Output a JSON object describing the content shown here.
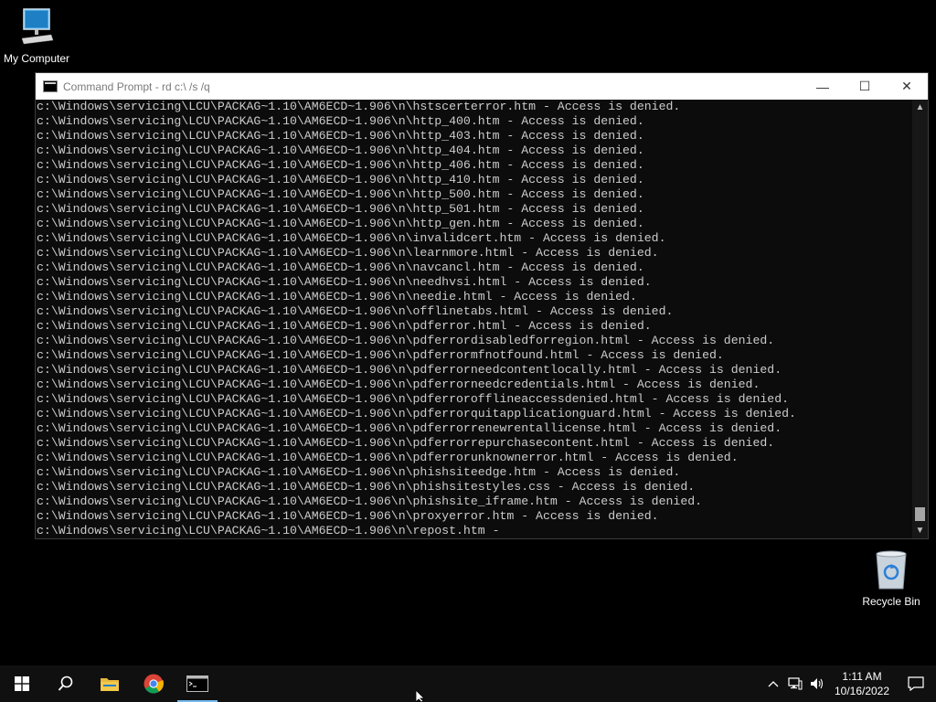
{
  "desktop": {
    "icons": [
      {
        "label": "My Computer",
        "icon": "computer-icon"
      },
      {
        "label": "Recycle Bin",
        "icon": "recycle-bin-icon"
      }
    ]
  },
  "window": {
    "title": "Command Prompt - rd  c:\\ /s /q",
    "minimize": "—",
    "maximize": "☐",
    "close": "✕"
  },
  "console": {
    "lines": [
      "c:\\Windows\\servicing\\LCU\\PACKAG~1.10\\AM6ECD~1.906\\n\\hstscerterror.htm - Access is denied.",
      "c:\\Windows\\servicing\\LCU\\PACKAG~1.10\\AM6ECD~1.906\\n\\http_400.htm - Access is denied.",
      "c:\\Windows\\servicing\\LCU\\PACKAG~1.10\\AM6ECD~1.906\\n\\http_403.htm - Access is denied.",
      "c:\\Windows\\servicing\\LCU\\PACKAG~1.10\\AM6ECD~1.906\\n\\http_404.htm - Access is denied.",
      "c:\\Windows\\servicing\\LCU\\PACKAG~1.10\\AM6ECD~1.906\\n\\http_406.htm - Access is denied.",
      "c:\\Windows\\servicing\\LCU\\PACKAG~1.10\\AM6ECD~1.906\\n\\http_410.htm - Access is denied.",
      "c:\\Windows\\servicing\\LCU\\PACKAG~1.10\\AM6ECD~1.906\\n\\http_500.htm - Access is denied.",
      "c:\\Windows\\servicing\\LCU\\PACKAG~1.10\\AM6ECD~1.906\\n\\http_501.htm - Access is denied.",
      "c:\\Windows\\servicing\\LCU\\PACKAG~1.10\\AM6ECD~1.906\\n\\http_gen.htm - Access is denied.",
      "c:\\Windows\\servicing\\LCU\\PACKAG~1.10\\AM6ECD~1.906\\n\\invalidcert.htm - Access is denied.",
      "c:\\Windows\\servicing\\LCU\\PACKAG~1.10\\AM6ECD~1.906\\n\\learnmore.html - Access is denied.",
      "c:\\Windows\\servicing\\LCU\\PACKAG~1.10\\AM6ECD~1.906\\n\\navcancl.htm - Access is denied.",
      "c:\\Windows\\servicing\\LCU\\PACKAG~1.10\\AM6ECD~1.906\\n\\needhvsi.html - Access is denied.",
      "c:\\Windows\\servicing\\LCU\\PACKAG~1.10\\AM6ECD~1.906\\n\\needie.html - Access is denied.",
      "c:\\Windows\\servicing\\LCU\\PACKAG~1.10\\AM6ECD~1.906\\n\\offlinetabs.html - Access is denied.",
      "c:\\Windows\\servicing\\LCU\\PACKAG~1.10\\AM6ECD~1.906\\n\\pdferror.html - Access is denied.",
      "c:\\Windows\\servicing\\LCU\\PACKAG~1.10\\AM6ECD~1.906\\n\\pdferrordisabledforregion.html - Access is denied.",
      "c:\\Windows\\servicing\\LCU\\PACKAG~1.10\\AM6ECD~1.906\\n\\pdferrormfnotfound.html - Access is denied.",
      "c:\\Windows\\servicing\\LCU\\PACKAG~1.10\\AM6ECD~1.906\\n\\pdferrorneedcontentlocally.html - Access is denied.",
      "c:\\Windows\\servicing\\LCU\\PACKAG~1.10\\AM6ECD~1.906\\n\\pdferrorneedcredentials.html - Access is denied.",
      "c:\\Windows\\servicing\\LCU\\PACKAG~1.10\\AM6ECD~1.906\\n\\pdferrorofflineaccessdenied.html - Access is denied.",
      "c:\\Windows\\servicing\\LCU\\PACKAG~1.10\\AM6ECD~1.906\\n\\pdferrorquitapplicationguard.html - Access is denied.",
      "c:\\Windows\\servicing\\LCU\\PACKAG~1.10\\AM6ECD~1.906\\n\\pdferrorrenewrentallicense.html - Access is denied.",
      "c:\\Windows\\servicing\\LCU\\PACKAG~1.10\\AM6ECD~1.906\\n\\pdferrorrepurchasecontent.html - Access is denied.",
      "c:\\Windows\\servicing\\LCU\\PACKAG~1.10\\AM6ECD~1.906\\n\\pdferrorunknownerror.html - Access is denied.",
      "c:\\Windows\\servicing\\LCU\\PACKAG~1.10\\AM6ECD~1.906\\n\\phishsiteedge.htm - Access is denied.",
      "c:\\Windows\\servicing\\LCU\\PACKAG~1.10\\AM6ECD~1.906\\n\\phishsitestyles.css - Access is denied.",
      "c:\\Windows\\servicing\\LCU\\PACKAG~1.10\\AM6ECD~1.906\\n\\phishsite_iframe.htm - Access is denied.",
      "c:\\Windows\\servicing\\LCU\\PACKAG~1.10\\AM6ECD~1.906\\n\\proxyerror.htm - Access is denied.",
      "c:\\Windows\\servicing\\LCU\\PACKAG~1.10\\AM6ECD~1.906\\n\\repost.htm -"
    ]
  },
  "taskbar": {
    "items": [
      {
        "name": "start-button",
        "icon": "windows-logo-icon"
      },
      {
        "name": "search-button",
        "icon": "search-icon"
      },
      {
        "name": "file-explorer-button",
        "icon": "folder-icon"
      },
      {
        "name": "chrome-button",
        "icon": "chrome-icon"
      },
      {
        "name": "command-prompt-button",
        "icon": "cmd-icon",
        "active": true
      }
    ],
    "tray": {
      "time": "1:11 AM",
      "date": "10/16/2022"
    }
  },
  "colors": {
    "console_bg": "#0c0c0c",
    "console_text": "#cccccc",
    "taskbar_bg": "#101010",
    "active_indicator": "#76b9ed"
  }
}
